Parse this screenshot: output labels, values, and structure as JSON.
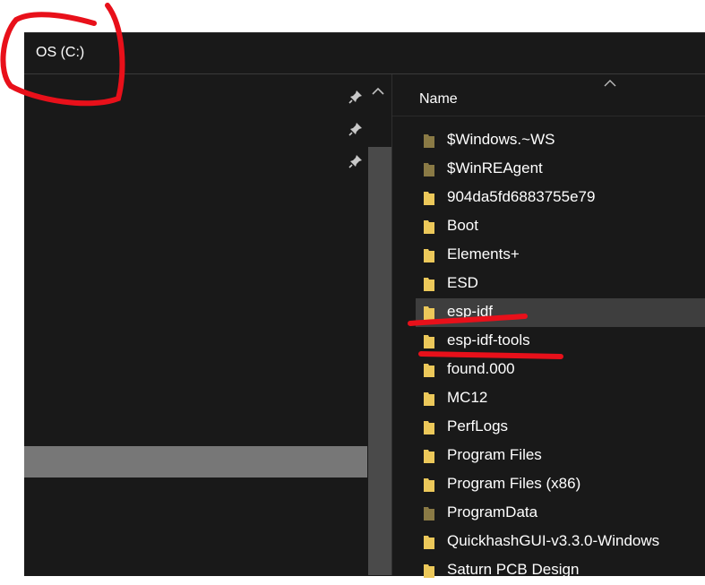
{
  "address_bar": {
    "path": "OS (C:)"
  },
  "file_list": {
    "column_name": "Name",
    "items": [
      {
        "name": "$Windows.~WS",
        "icon": "folder-hidden-icon"
      },
      {
        "name": "$WinREAgent",
        "icon": "folder-hidden-icon"
      },
      {
        "name": "904da5fd6883755e79",
        "icon": "folder-icon"
      },
      {
        "name": "Boot",
        "icon": "folder-icon"
      },
      {
        "name": "Elements+",
        "icon": "folder-icon"
      },
      {
        "name": "ESD",
        "icon": "folder-icon"
      },
      {
        "name": "esp-idf",
        "icon": "folder-icon",
        "selected": true
      },
      {
        "name": "esp-idf-tools",
        "icon": "folder-icon"
      },
      {
        "name": "found.000",
        "icon": "folder-icon"
      },
      {
        "name": "MC12",
        "icon": "folder-icon"
      },
      {
        "name": "PerfLogs",
        "icon": "folder-icon"
      },
      {
        "name": "Program Files",
        "icon": "folder-icon"
      },
      {
        "name": "Program Files (x86)",
        "icon": "folder-icon"
      },
      {
        "name": "ProgramData",
        "icon": "folder-hidden-icon"
      },
      {
        "name": "QuickhashGUI-v3.3.0-Windows",
        "icon": "folder-icon"
      },
      {
        "name": "Saturn PCB Design",
        "icon": "folder-icon"
      }
    ]
  },
  "colors": {
    "background": "#191919",
    "selected_row": "#3e3e3e",
    "folder_yellow": "#ecc85a",
    "folder_hidden": "#8a7a45",
    "annotation_red": "#e8101a"
  }
}
